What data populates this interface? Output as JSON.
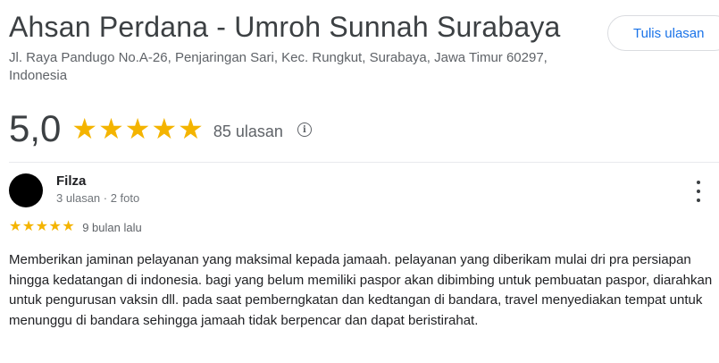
{
  "place": {
    "name": "Ahsan Perdana - Umroh Sunnah Surabaya",
    "address": "Jl. Raya Pandugo No.A-26, Penjaringan Sari, Kec. Rungkut, Surabaya, Jawa Timur 60297, Indonesia",
    "write_review_label": "Tulis ulasan"
  },
  "rating": {
    "value": "5,0",
    "stars": 5,
    "review_count": "85 ulasan",
    "star_color": "#f4b400"
  },
  "review": {
    "reviewer_name": "Filza",
    "reviewer_meta": "3 ulasan · 2 foto",
    "stars": 5,
    "time": "9 bulan lalu",
    "text": "Memberikan jaminan pelayanan yang maksimal kepada jamaah. pelayanan yang diberikam mulai dri pra persiapan hingga kedatangan di indonesia. bagi yang belum memiliki paspor akan dibimbing untuk pembuatan paspor, diarahkan untuk pengurusan vaksin dll. pada saat pemberngkatan dan kedtangan di bandara, travel menyediakan tempat untuk menunggu di bandara sehingga jamaah tidak berpencar dan dapat beristirahat."
  },
  "icons": {
    "star": "star-icon",
    "info": "info-icon",
    "more": "more-vert-icon"
  }
}
